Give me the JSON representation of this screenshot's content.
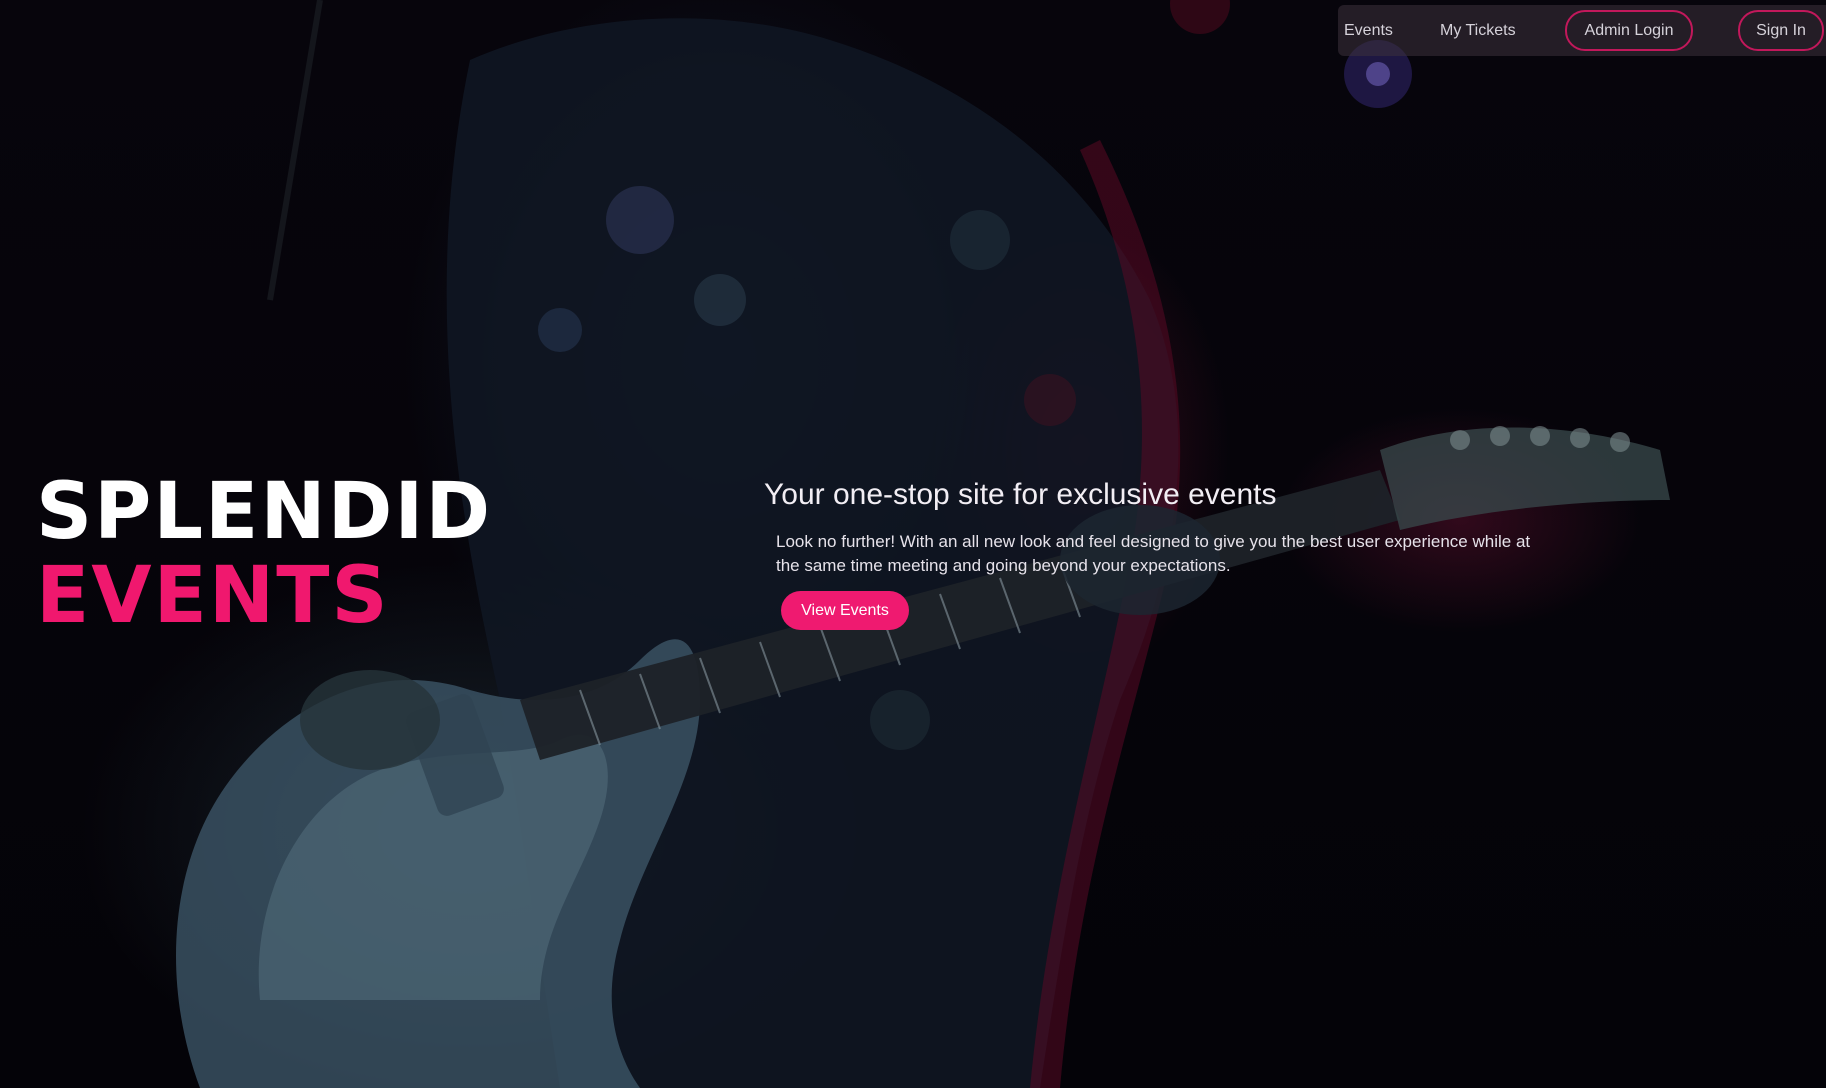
{
  "nav": {
    "events": "Events",
    "my_tickets": "My Tickets",
    "admin_login": "Admin Login",
    "sign_in": "Sign In"
  },
  "brand": {
    "line1": "SPLENDID",
    "line2": "EVENTS"
  },
  "hero": {
    "headline": "Your one-stop site for exclusive events",
    "description": "Look no further! With an all new look and feel designed to give you the best user experience while at the same time meeting and going beyond your expectations.",
    "cta_label": "View Events"
  },
  "colors": {
    "accent": "#ef1a70",
    "background": "#05030a",
    "text": "#ffffff"
  }
}
